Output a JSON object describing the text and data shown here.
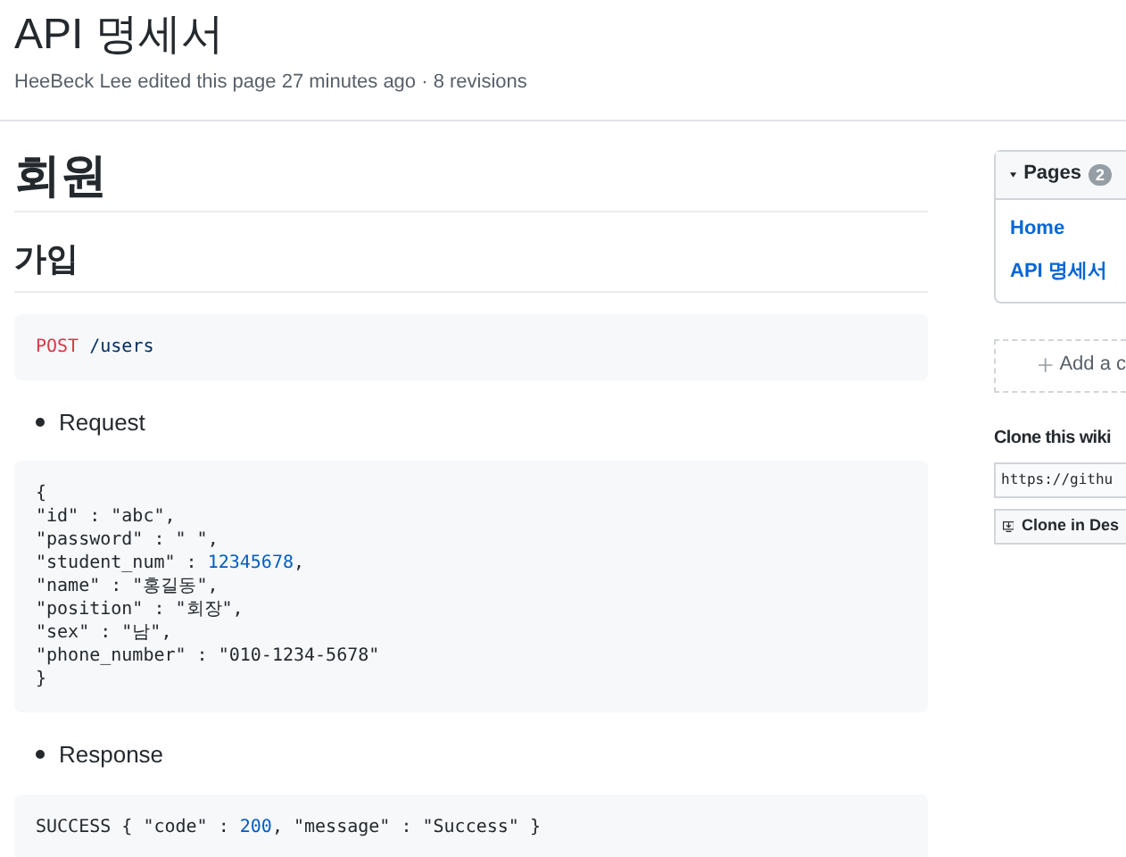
{
  "page": {
    "title": "API 명세서",
    "meta": "HeeBeck Lee edited this page 27 minutes ago · 8 revisions"
  },
  "content": [
    {
      "kind": "h1",
      "text": "회원"
    },
    {
      "kind": "h2",
      "text": "가입"
    },
    {
      "kind": "code",
      "lines": [
        [
          {
            "kind": "keyword",
            "text": "POST"
          },
          {
            "kind": "path",
            "text": " /users"
          }
        ]
      ]
    },
    {
      "kind": "bullet",
      "text": "Request"
    },
    {
      "kind": "code",
      "lines": [
        [
          {
            "kind": "plain",
            "text": "{"
          }
        ],
        [
          {
            "kind": "plain",
            "text": "\"id\" : \"abc\","
          }
        ],
        [
          {
            "kind": "plain",
            "text": "\"password\" : \" \","
          }
        ],
        [
          {
            "kind": "plain",
            "text": "\"student_num\" : "
          },
          {
            "kind": "number",
            "text": "12345678"
          },
          {
            "kind": "plain",
            "text": ","
          }
        ],
        [
          {
            "kind": "plain",
            "text": "\"name\" : \"홍길동\","
          }
        ],
        [
          {
            "kind": "plain",
            "text": "\"position\" : \"회장\","
          }
        ],
        [
          {
            "kind": "plain",
            "text": "\"sex\" : \"남\","
          }
        ],
        [
          {
            "kind": "plain",
            "text": "\"phone_number\" : \"010-1234-5678\""
          }
        ],
        [
          {
            "kind": "plain",
            "text": "}"
          }
        ]
      ]
    },
    {
      "kind": "bullet",
      "text": "Response"
    },
    {
      "kind": "code",
      "lines": [
        [
          {
            "kind": "plain",
            "text": "SUCCESS { \"code\" : "
          },
          {
            "kind": "number",
            "text": "200"
          },
          {
            "kind": "plain",
            "text": ", \"message\" : \"Success\" }"
          }
        ]
      ]
    }
  ],
  "sidebar": {
    "pages": {
      "title": "Pages",
      "count": "2",
      "expanded": true,
      "items": [
        "Home",
        "API 명세서"
      ]
    },
    "add_button": "Add a c",
    "clone_title": "Clone this wiki",
    "clone_url": "https://githu",
    "clone_button": "Clone in Des"
  }
}
